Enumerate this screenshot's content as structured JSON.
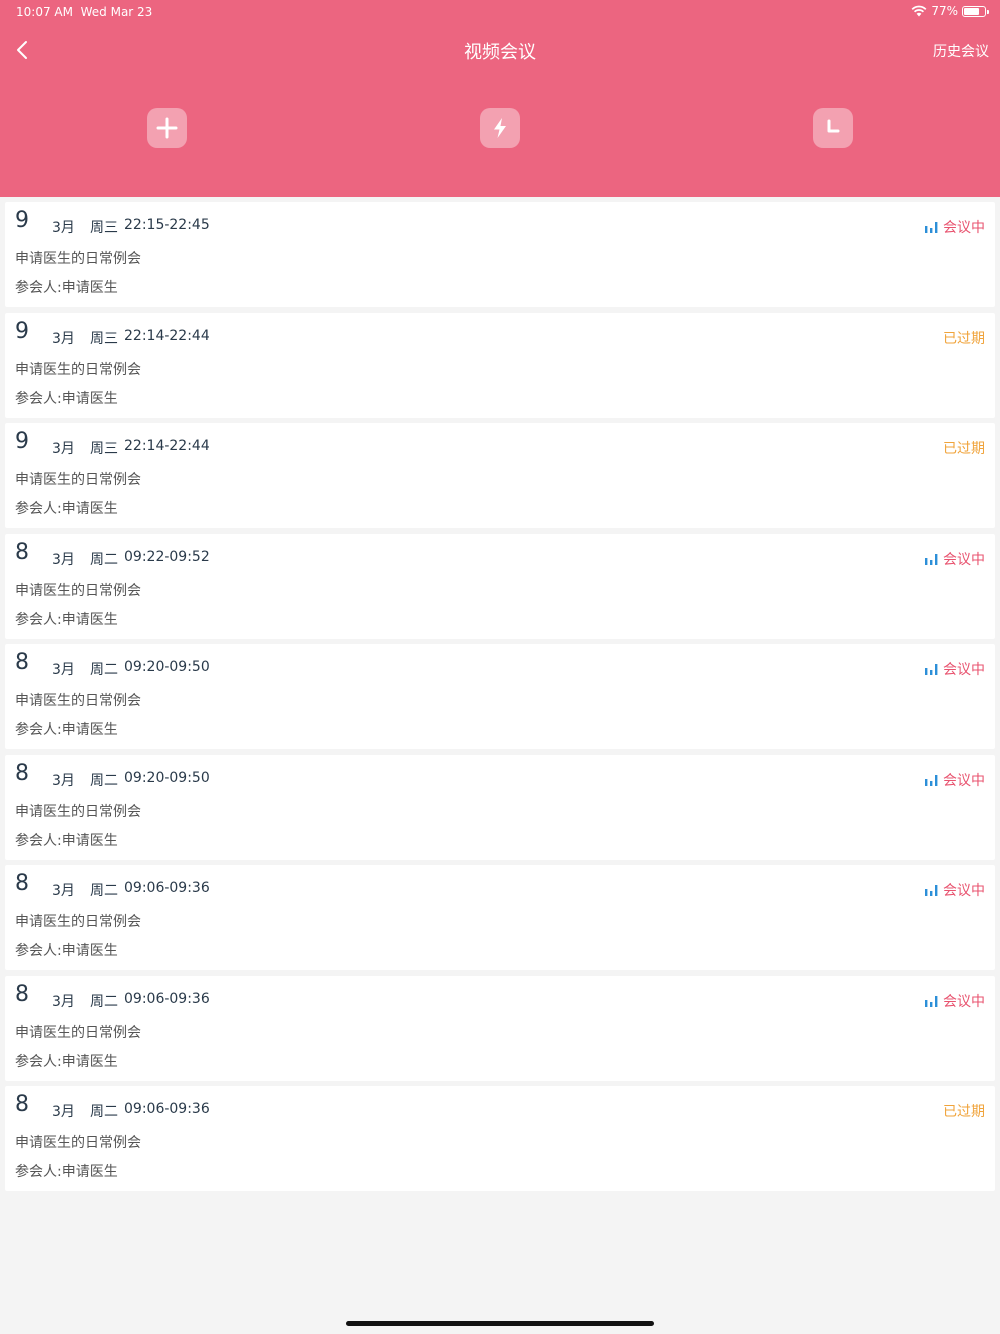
{
  "status_bar": {
    "time": "10:07 AM",
    "date": "Wed Mar 23",
    "battery": "77%",
    "battery_level": 0.77
  },
  "nav": {
    "title": "视频会议",
    "history_label": "历史会议"
  },
  "actions": [
    {
      "name": "create-meeting-button",
      "icon": "plus-icon"
    },
    {
      "name": "quick-meeting-button",
      "icon": "lightning-icon"
    },
    {
      "name": "scheduled-meeting-button",
      "icon": "clock-icon"
    }
  ],
  "colors": {
    "header": "#ec6580",
    "live": "#e8536f",
    "expired": "#f0a33a",
    "live_icon": "#2c8fd8"
  },
  "meetings": [
    {
      "day": "9",
      "month": "3月",
      "weekday": "周三",
      "time": "22:15-22:45",
      "title": "申请医生的日常例会",
      "participants": "参会人:申请医生",
      "status": "会议中",
      "live": true
    },
    {
      "day": "9",
      "month": "3月",
      "weekday": "周三",
      "time": "22:14-22:44",
      "title": "申请医生的日常例会",
      "participants": "参会人:申请医生",
      "status": "已过期",
      "live": false
    },
    {
      "day": "9",
      "month": "3月",
      "weekday": "周三",
      "time": "22:14-22:44",
      "title": "申请医生的日常例会",
      "participants": "参会人:申请医生",
      "status": "已过期",
      "live": false
    },
    {
      "day": "8",
      "month": "3月",
      "weekday": "周二",
      "time": "09:22-09:52",
      "title": "申请医生的日常例会",
      "participants": "参会人:申请医生",
      "status": "会议中",
      "live": true
    },
    {
      "day": "8",
      "month": "3月",
      "weekday": "周二",
      "time": "09:20-09:50",
      "title": "申请医生的日常例会",
      "participants": "参会人:申请医生",
      "status": "会议中",
      "live": true
    },
    {
      "day": "8",
      "month": "3月",
      "weekday": "周二",
      "time": "09:20-09:50",
      "title": "申请医生的日常例会",
      "participants": "参会人:申请医生",
      "status": "会议中",
      "live": true
    },
    {
      "day": "8",
      "month": "3月",
      "weekday": "周二",
      "time": "09:06-09:36",
      "title": "申请医生的日常例会",
      "participants": "参会人:申请医生",
      "status": "会议中",
      "live": true
    },
    {
      "day": "8",
      "month": "3月",
      "weekday": "周二",
      "time": "09:06-09:36",
      "title": "申请医生的日常例会",
      "participants": "参会人:申请医生",
      "status": "会议中",
      "live": true
    },
    {
      "day": "8",
      "month": "3月",
      "weekday": "周二",
      "time": "09:06-09:36",
      "title": "申请医生的日常例会",
      "participants": "参会人:申请医生",
      "status": "已过期",
      "live": false
    }
  ]
}
